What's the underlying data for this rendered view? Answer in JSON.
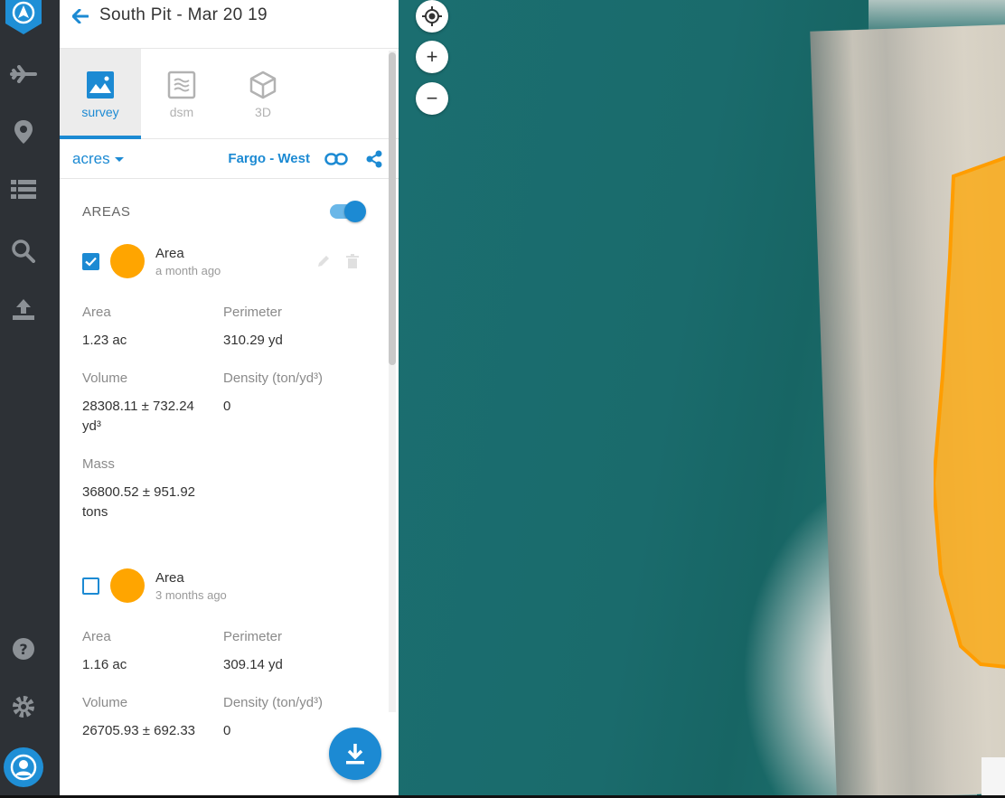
{
  "header": {
    "title": "South Pit - Mar 20 19"
  },
  "tabs": [
    {
      "label": "survey",
      "icon": "image-icon",
      "active": true
    },
    {
      "label": "dsm",
      "icon": "dsm-layers-icon",
      "active": false
    },
    {
      "label": "3D",
      "icon": "cube-icon",
      "active": false
    }
  ],
  "toolbar": {
    "units": "acres",
    "site": "Fargo - West"
  },
  "section": {
    "label": "AREAS",
    "toggle_on": true
  },
  "areas": [
    {
      "checked": true,
      "color": "#ffa500",
      "name": "Area",
      "when": "a month ago",
      "stats": {
        "area_label": "Area",
        "area_value": "1.23 ac",
        "perimeter_label": "Perimeter",
        "perimeter_value": "310.29 yd",
        "volume_label": "Volume",
        "volume_value": "28308.11 ± 732.24 yd³",
        "density_label": "Density (ton/yd³)",
        "density_value": "0",
        "mass_label": "Mass",
        "mass_value": "36800.52 ± 951.92 tons"
      }
    },
    {
      "checked": false,
      "color": "#ffa500",
      "name": "Area",
      "when": "3 months ago",
      "stats": {
        "area_label": "Area",
        "area_value": "1.16 ac",
        "perimeter_label": "Perimeter",
        "perimeter_value": "309.14 yd",
        "volume_label": "Volume",
        "volume_value": "26705.93 ± 692.33",
        "density_label": "Density (ton/yd³)",
        "density_value": "0"
      }
    }
  ],
  "map_controls": {
    "zoom_in": "+",
    "zoom_out": "−"
  },
  "colors": {
    "accent": "#1c8ad3",
    "rail": "#2d3136",
    "area": "#ffa500"
  }
}
